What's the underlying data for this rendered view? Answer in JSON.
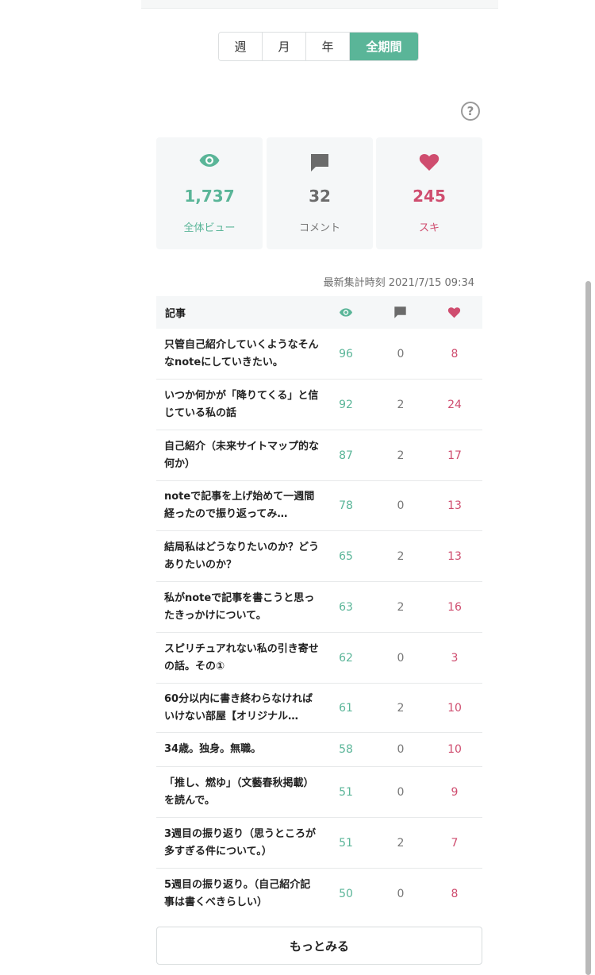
{
  "period_tabs": {
    "week": "週",
    "month": "月",
    "year": "年",
    "all": "全期間",
    "selected": "全期間"
  },
  "help_icon": "question-circle-icon",
  "summary": {
    "views": {
      "value": "1,737",
      "label": "全体ビュー",
      "icon": "eye-icon"
    },
    "comments": {
      "value": "32",
      "label": "コメント",
      "icon": "comment-icon"
    },
    "likes": {
      "value": "245",
      "label": "スキ",
      "icon": "heart-icon"
    }
  },
  "updated_at": "最新集計時刻 2021/7/15 09:34",
  "table": {
    "header_title": "記事",
    "rows": [
      {
        "title": "只管自己紹介していくようなそんなnoteにしていきたい。",
        "views": "96",
        "comments": "0",
        "likes": "8"
      },
      {
        "title": "いつか何かが「降りてくる」と信じている私の話",
        "views": "92",
        "comments": "2",
        "likes": "24"
      },
      {
        "title": "自己紹介（未来サイトマップ的な何か）",
        "views": "87",
        "comments": "2",
        "likes": "17"
      },
      {
        "title": "noteで記事を上げ始めて一週間経ったので振り返ってみ…",
        "views": "78",
        "comments": "0",
        "likes": "13"
      },
      {
        "title": "結局私はどうなりたいのか？どうありたいのか？",
        "views": "65",
        "comments": "2",
        "likes": "13"
      },
      {
        "title": "私がnoteで記事を書こうと思ったきっかけについて。",
        "views": "63",
        "comments": "2",
        "likes": "16"
      },
      {
        "title": "スピリチュアれない私の引き寄せの話。その①",
        "views": "62",
        "comments": "0",
        "likes": "3"
      },
      {
        "title": "60分以内に書き終わらなければいけない部屋【オリジナル…",
        "views": "61",
        "comments": "2",
        "likes": "10"
      },
      {
        "title": "34歳。独身。無職。",
        "views": "58",
        "comments": "0",
        "likes": "10"
      },
      {
        "title": "「推し、燃ゆ」（文藝春秋掲載）を読んで。",
        "views": "51",
        "comments": "0",
        "likes": "9"
      },
      {
        "title": "3週目の振り返り（思うところが多すぎる件について。）",
        "views": "51",
        "comments": "2",
        "likes": "7"
      },
      {
        "title": "5週目の振り返り。（自己紹介記事は書くべきらしい）",
        "views": "50",
        "comments": "0",
        "likes": "8"
      }
    ]
  },
  "more_button": "もっとみる",
  "colors": {
    "accent_green": "#5ab598",
    "like_red": "#cf4d6f",
    "comment_gray": "#6b6b6b",
    "panel_bg": "#f5f7f8"
  }
}
